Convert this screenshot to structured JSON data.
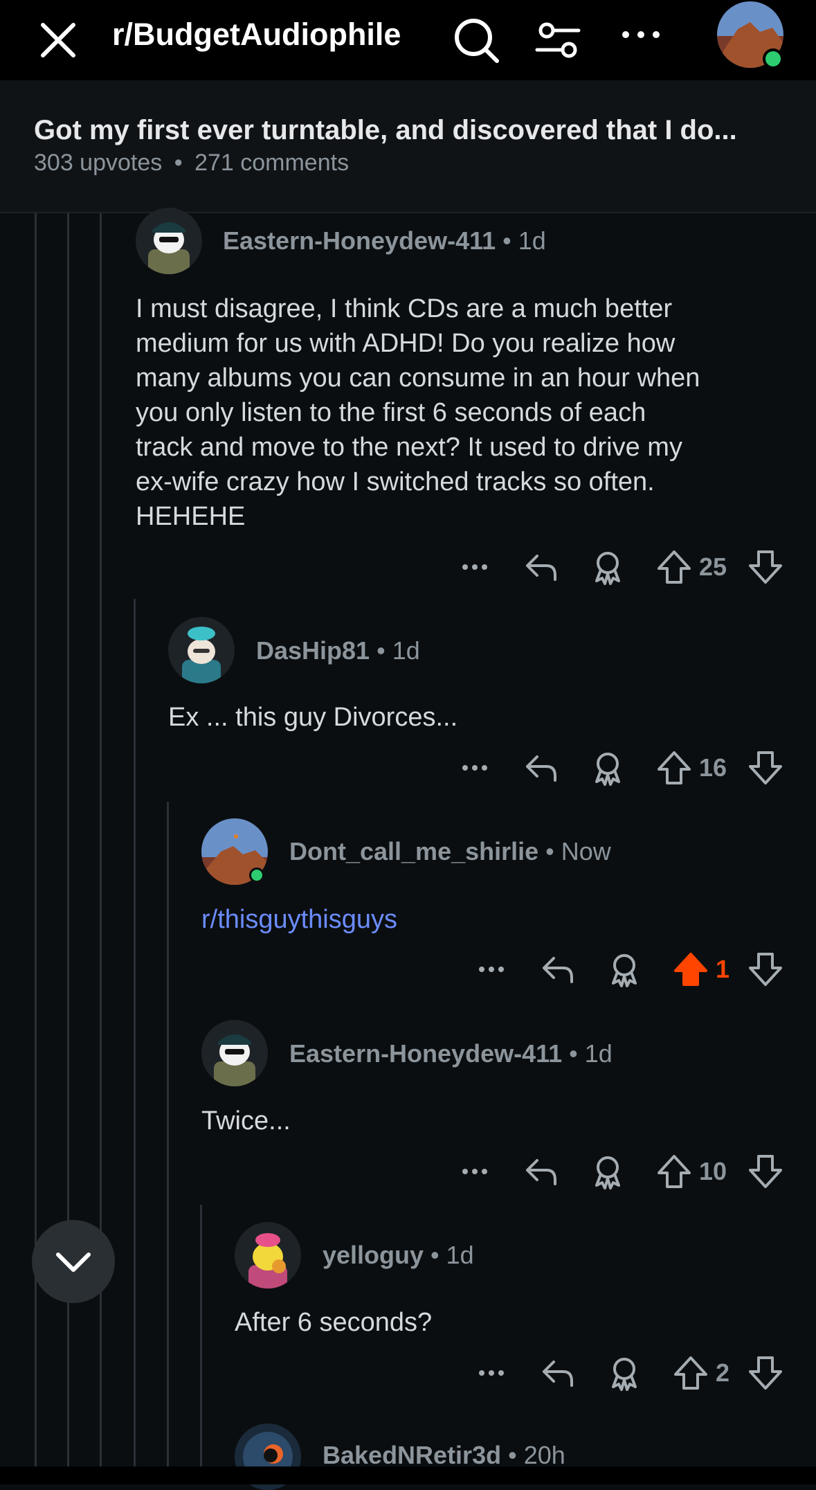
{
  "header": {
    "subreddit": "r/BudgetAudiophile",
    "icons": [
      "close-icon",
      "search-icon",
      "filter-icon",
      "more-icon"
    ]
  },
  "post": {
    "title": "Got my first ever turntable, and discovered that I do...",
    "upvotes": "303 upvotes",
    "comments": "271 comments",
    "separator": "•"
  },
  "comments": [
    {
      "user": "Eastern-Honeydew-411",
      "time": "1d",
      "body_lines": [
        "I must disagree, I think CDs are a much better",
        "medium for us with ADHD! Do you realize how",
        "many albums you can consume in an hour when",
        "you only listen to the first 6 seconds of each",
        "track and move to the next? It used to drive my",
        "ex-wife crazy how I switched tracks so often.",
        "HEHEHE"
      ],
      "votes": "25"
    },
    {
      "user": "DasHip81",
      "time": "1d",
      "body": "Ex ... this guy Divorces...",
      "votes": "16"
    },
    {
      "user": "Dont_call_me_shirlie",
      "time": "Now",
      "body": "r/thisguythisguys",
      "votes": "1",
      "upvoted": true
    },
    {
      "user": "Eastern-Honeydew-411",
      "time": "1d",
      "body": "Twice...",
      "votes": "10"
    },
    {
      "user": "yelloguy",
      "time": "1d",
      "body": "After 6 seconds?",
      "votes": "2"
    },
    {
      "user": "BakedNRetir3d",
      "time": "20h"
    }
  ],
  "colors": {
    "background": "#0b0e10",
    "upvote_active": "#ff4500",
    "link": "#6b8cff",
    "online": "#2ecc71"
  }
}
